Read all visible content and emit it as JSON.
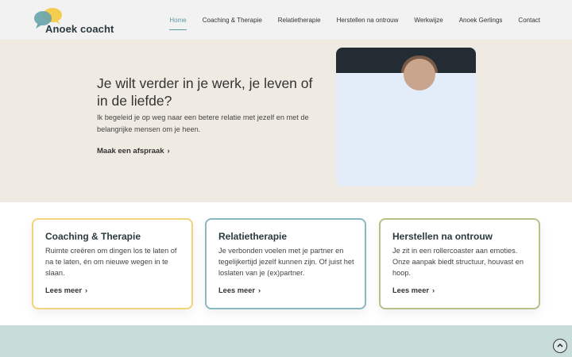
{
  "brand": {
    "name": "Anoek coacht",
    "colors": {
      "bubble_yellow": "#f4cc4e",
      "bubble_teal": "#6aa6ad",
      "accent": "#5e9aa6"
    }
  },
  "nav": {
    "items": [
      {
        "label": "Home",
        "active": true
      },
      {
        "label": "Coaching & Therapie",
        "active": false
      },
      {
        "label": "Relatietherapie",
        "active": false
      },
      {
        "label": "Herstellen na ontrouw",
        "active": false
      },
      {
        "label": "Werkwijze",
        "active": false
      },
      {
        "label": "Anoek Gerlings",
        "active": false
      },
      {
        "label": "Contact",
        "active": false
      }
    ]
  },
  "hero": {
    "title": "Je wilt verder in je werk, je leven of in de liefde?",
    "text": "Ik begeleid je op weg naar een betere relatie met jezelf en met de belangrijke mensen om je heen.",
    "cta": "Maak een afspraak",
    "cta_icon": "chevron-right-icon"
  },
  "cards": [
    {
      "title": "Coaching & Therapie",
      "text": "Ruimte creëren om dingen los te laten of na te laten, én om nieuwe wegen in te slaan.",
      "link": "Lees meer",
      "border_color": "#f1d57a"
    },
    {
      "title": "Relatietherapie",
      "text": "Je verbonden voelen met je partner en tegelijkertijd jezelf kunnen zijn. Of juist het loslaten van je (ex)partner.",
      "link": "Lees meer",
      "border_color": "#8bb7c2"
    },
    {
      "title": "Herstellen na ontrouw",
      "text": "Je zit in een rollercoaster aan emoties. Onze aanpak biedt structuur, houvast en hoop.",
      "link": "Lees meer",
      "border_color": "#b8c08a"
    }
  ],
  "scroll_top_icon": "arrow-up-circle-icon"
}
